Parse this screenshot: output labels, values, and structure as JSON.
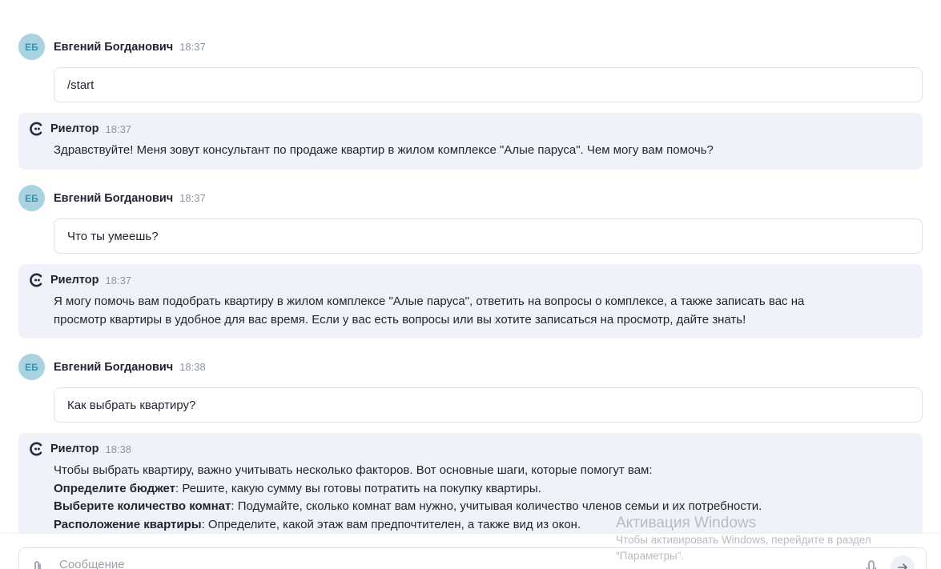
{
  "messages": [
    {
      "type": "user",
      "avatar": "ЕБ",
      "author": "Евгений Богданович",
      "time": "18:37",
      "text": "/start"
    },
    {
      "type": "bot",
      "author": "Риелтор",
      "time": "18:37",
      "text": "Здравствуйте! Меня зовут консультант по продаже квартир в жилом комплексе \"Алые паруса\". Чем могу вам помочь?"
    },
    {
      "type": "user",
      "avatar": "ЕБ",
      "author": "Евгений Богданович",
      "time": "18:37",
      "text": "Что ты умеешь?"
    },
    {
      "type": "bot",
      "author": "Риелтор",
      "time": "18:37",
      "line1": "Я могу помочь вам подобрать квартиру в жилом комплексе \"Алые паруса\", ответить на вопросы о комплексе, а также записать вас на",
      "line2": "просмотр квартиры в удобное для вас время. Если у вас есть вопросы или вы хотите записаться на просмотр, дайте знать!"
    },
    {
      "type": "user",
      "avatar": "ЕБ",
      "author": "Евгений Богданович",
      "time": "18:38",
      "text": "Как выбрать квартиру?"
    },
    {
      "type": "bot",
      "author": "Риелтор",
      "time": "18:38",
      "intro": "Чтобы выбрать квартиру, важно учитывать несколько факторов. Вот основные шаги, которые помогут вам:",
      "steps": [
        {
          "title": "Определите бюджет",
          "text": ": Решите, какую сумму вы готовы потратить на покупку квартиры."
        },
        {
          "title": "Выберите количество комнат",
          "text": ": Подумайте, сколько комнат вам нужно, учитывая количество членов семьи и их потребности."
        },
        {
          "title": "Расположение квартиры",
          "text": ": Определите, какой этаж вам предпочтителен, а также вид из окон."
        }
      ]
    }
  ],
  "composer": {
    "placeholder": "Сообщение"
  },
  "windows_activation": {
    "title": "Активация Windows",
    "line1": "Чтобы активировать Windows, перейдите в раздел",
    "line2": "\"Параметры\"."
  },
  "colors": {
    "avatar_bg": "#a9d3e0",
    "bot_bg": "#eff2f9",
    "border": "#dde1e8",
    "text": "#1f2430",
    "muted": "#8d95a3"
  },
  "icons": {
    "bot_logo": "chat-bot-logo-icon",
    "attach": "paperclip-icon",
    "mic": "microphone-icon",
    "send": "arrow-right-icon"
  }
}
